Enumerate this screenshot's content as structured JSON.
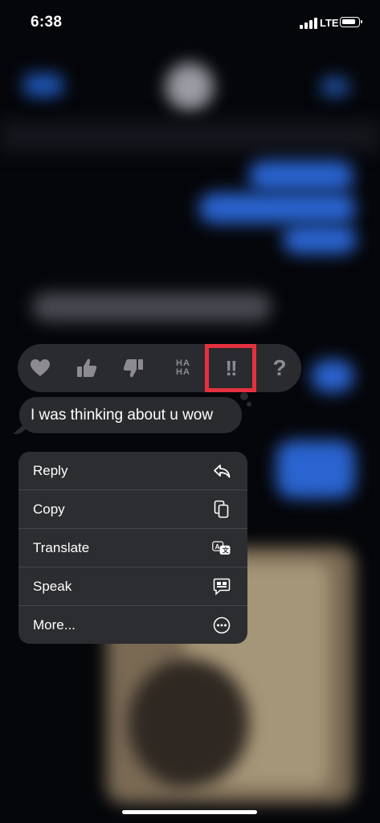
{
  "status_bar": {
    "time": "6:38",
    "network": "LTE"
  },
  "reactions": [
    {
      "name": "heart",
      "selected": false
    },
    {
      "name": "thumbs-up",
      "selected": false
    },
    {
      "name": "thumbs-down",
      "selected": false
    },
    {
      "name": "haha",
      "text_top": "HA",
      "text_bottom": "HA",
      "selected": false
    },
    {
      "name": "exclamation",
      "text": "!!",
      "selected": true
    },
    {
      "name": "question",
      "text": "?",
      "selected": false
    }
  ],
  "message": {
    "text": "I was thinking about u wow"
  },
  "menu": {
    "items": [
      {
        "label": "Reply",
        "icon": "reply-icon"
      },
      {
        "label": "Copy",
        "icon": "copy-icon"
      },
      {
        "label": "Translate",
        "icon": "translate-icon"
      },
      {
        "label": "Speak",
        "icon": "speak-icon"
      },
      {
        "label": "More...",
        "icon": "more-icon"
      }
    ]
  },
  "colors": {
    "selection_outline": "#e5313f",
    "panel": "#2c2d30",
    "bubble_blue": "#2f6fe0"
  }
}
